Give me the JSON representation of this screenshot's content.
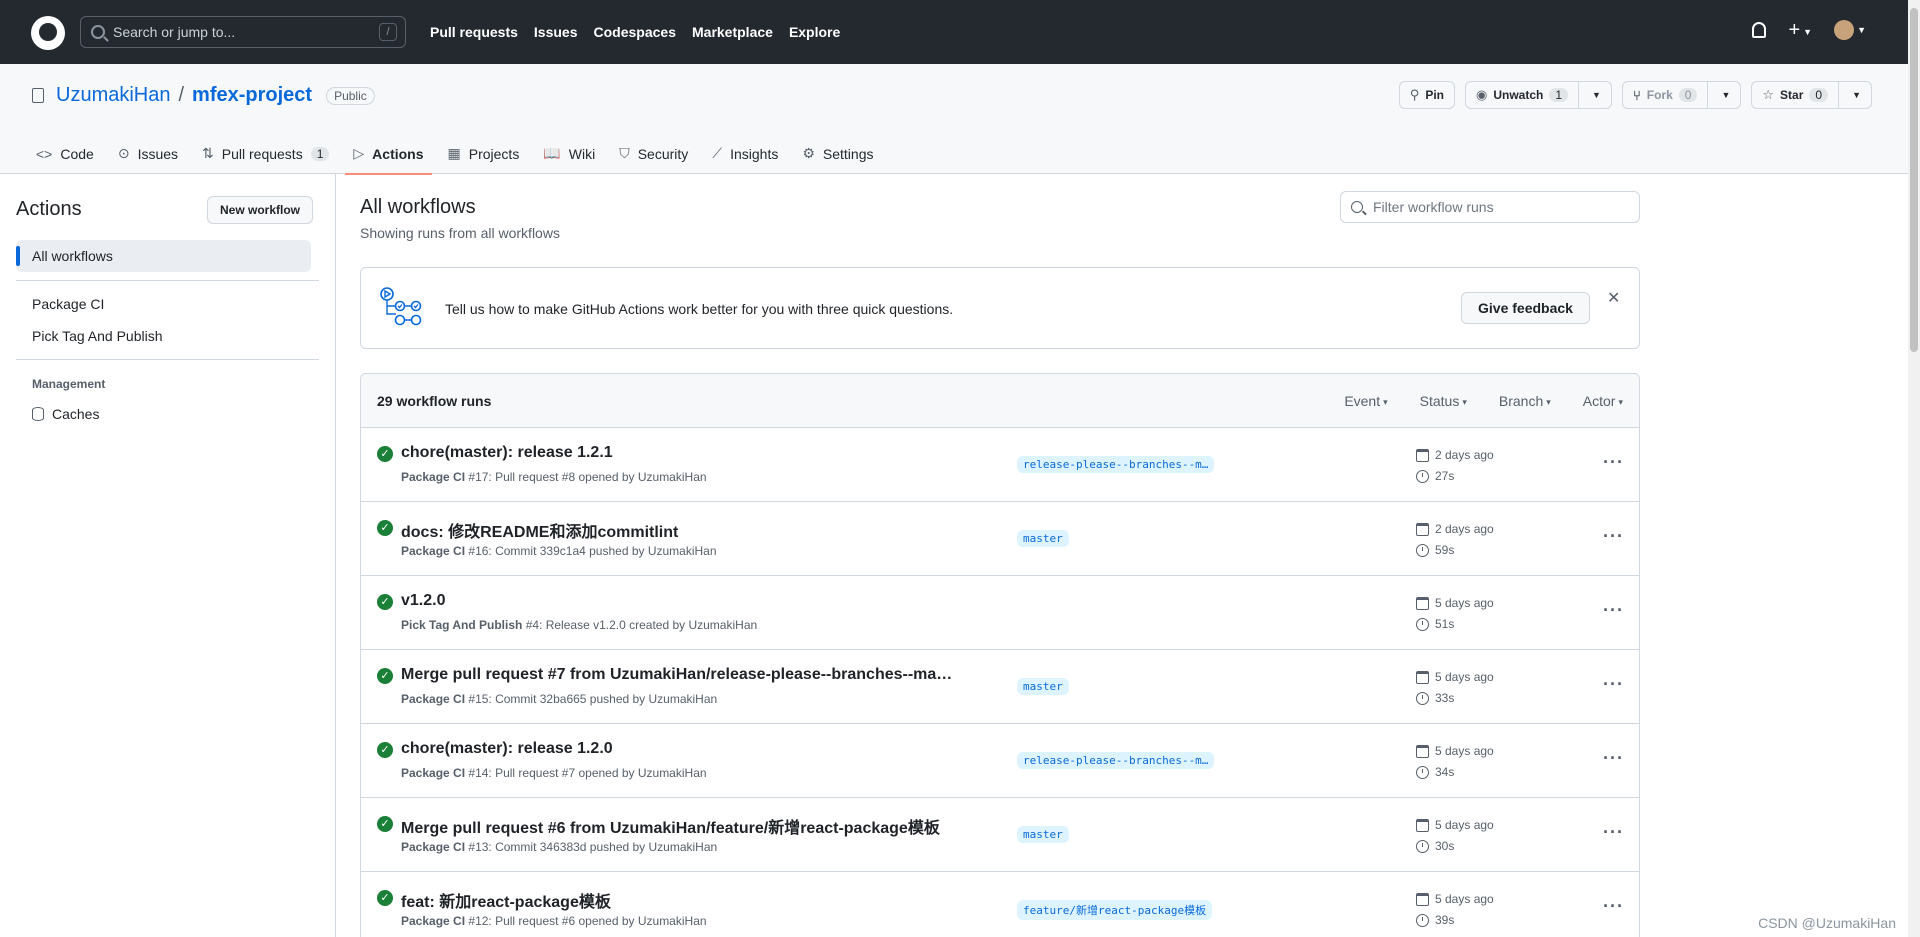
{
  "header": {
    "search_placeholder": "Search or jump to...",
    "search_shortcut": "/",
    "nav": [
      "Pull requests",
      "Issues",
      "Codespaces",
      "Marketplace",
      "Explore"
    ],
    "plus": "+"
  },
  "repo": {
    "owner": "UzumakiHan",
    "separator": "/",
    "name": "mfex-project",
    "visibility": "Public",
    "pin_label": "Pin",
    "unwatch_label": "Unwatch",
    "unwatch_count": "1",
    "fork_label": "Fork",
    "fork_count": "0",
    "star_label": "Star",
    "star_count": "0"
  },
  "tabs": [
    {
      "label": "Code",
      "icon": "<>"
    },
    {
      "label": "Issues",
      "icon": "⊙"
    },
    {
      "label": "Pull requests",
      "icon": "⇅",
      "count": "1"
    },
    {
      "label": "Actions",
      "icon": "▷"
    },
    {
      "label": "Projects",
      "icon": "▦"
    },
    {
      "label": "Wiki",
      "icon": "📖"
    },
    {
      "label": "Security",
      "icon": "⛉"
    },
    {
      "label": "Insights",
      "icon": "⟋"
    },
    {
      "label": "Settings",
      "icon": "⚙"
    }
  ],
  "sidebar": {
    "title": "Actions",
    "new_workflow": "New workflow",
    "all_workflows": "All workflows",
    "workflows": [
      "Package CI",
      "Pick Tag And Publish"
    ],
    "management_label": "Management",
    "caches": "Caches"
  },
  "main": {
    "title": "All workflows",
    "subtitle": "Showing runs from all workflows",
    "filter_placeholder": "Filter workflow runs",
    "feedback_text": "Tell us how to make GitHub Actions work better for you with three quick questions.",
    "feedback_button": "Give feedback",
    "close": "✕",
    "runs_count": "29 workflow runs",
    "filters": [
      "Event",
      "Status",
      "Branch",
      "Actor"
    ]
  },
  "runs": [
    {
      "title": "chore(master): release 1.2.1",
      "workflow": "Package CI",
      "detail": "#17: Pull request #8 opened by UzumakiHan",
      "branch": "release-please--branches--m…",
      "date": "2 days ago",
      "duration": "27s"
    },
    {
      "title": "docs: 修改README和添加commitlint",
      "workflow": "Package CI",
      "detail": "#16: Commit 339c1a4 pushed by UzumakiHan",
      "branch": "master",
      "date": "2 days ago",
      "duration": "59s"
    },
    {
      "title": "v1.2.0",
      "workflow": "Pick Tag And Publish",
      "detail": "#4: Release v1.2.0 created by UzumakiHan",
      "branch": "",
      "date": "5 days ago",
      "duration": "51s"
    },
    {
      "title": "Merge pull request #7 from UzumakiHan/release-please--branches--maste...",
      "workflow": "Package CI",
      "detail": "#15: Commit 32ba665 pushed by UzumakiHan",
      "branch": "master",
      "date": "5 days ago",
      "duration": "33s"
    },
    {
      "title": "chore(master): release 1.2.0",
      "workflow": "Package CI",
      "detail": "#14: Pull request #7 opened by UzumakiHan",
      "branch": "release-please--branches--m…",
      "date": "5 days ago",
      "duration": "34s"
    },
    {
      "title": "Merge pull request #6 from UzumakiHan/feature/新增react-package模板",
      "workflow": "Package CI",
      "detail": "#13: Commit 346383d pushed by UzumakiHan",
      "branch": "master",
      "date": "5 days ago",
      "duration": "30s"
    },
    {
      "title": "feat: 新加react-package模板",
      "workflow": "Package CI",
      "detail": "#12: Pull request #6 opened by UzumakiHan",
      "branch": "feature/新增react-package模板",
      "date": "5 days ago",
      "duration": "39s"
    }
  ],
  "watermark": "CSDN @UzumakiHan",
  "colors": {
    "header_bg": "#24292f",
    "link": "#0969da",
    "success": "#1a7f37",
    "active_tab_underline": "#fd8c73"
  }
}
